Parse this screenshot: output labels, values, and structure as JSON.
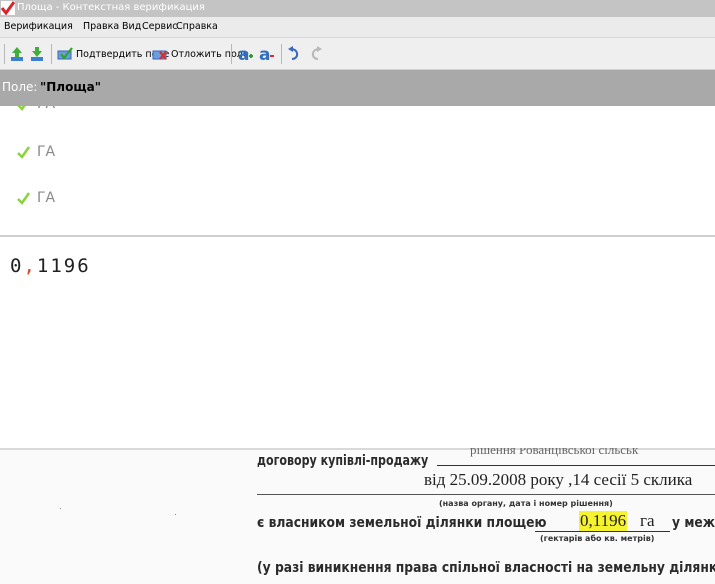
{
  "window": {
    "title": "Площа - Контекстная верификация"
  },
  "menu": {
    "items": [
      "Верификация",
      "Правка",
      "Вид",
      "Сервис",
      "Справка"
    ]
  },
  "toolbar": {
    "confirm_label": "Подтвердить поле",
    "postpone_label": "Отложить поле"
  },
  "field": {
    "label": "Поле:",
    "name": "\"Площа\""
  },
  "suggestions": [
    "ГА",
    "ГА",
    "ГА"
  ],
  "entry": {
    "whole": "0",
    "comma": ",",
    "fraction": "1196"
  },
  "document": {
    "line1": "договору купівлі-продажу",
    "line1_ghost": "рішення  Рованцівської сільськ",
    "line2": "від 25.09.2008 року ,14 сесії 5 склика",
    "caption1": "(назва органу, дата і номер рішення)",
    "line3": "є власником земельної ділянки площею",
    "value": "0,1196",
    "unit": "га",
    "line3_end": "у межа",
    "caption2": "(гектарів або кв. метрів)",
    "line4": "(у разі виникнення права спільної власності на земельну ділянку д"
  },
  "colors": {
    "field_bar": "#a9a9a9",
    "check_green": "#8bd23c",
    "highlight": "#f5f230",
    "comma_accent": "#d24a1e"
  }
}
